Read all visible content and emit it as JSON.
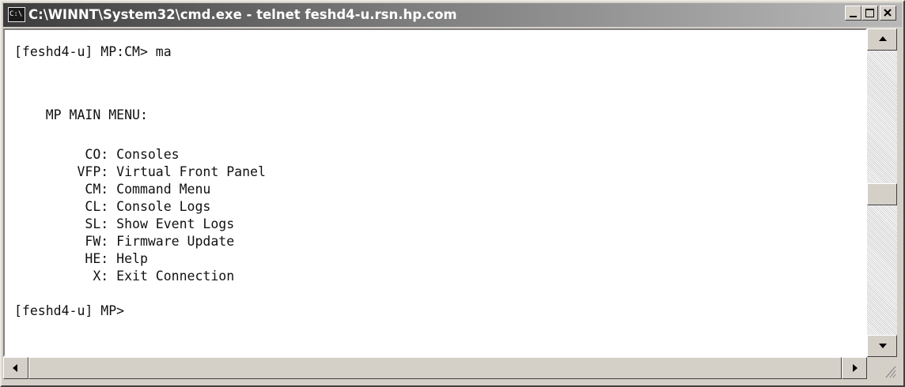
{
  "window": {
    "title": "C:\\WINNT\\System32\\cmd.exe - telnet feshd4-u.rsn.hp.com",
    "icon": "cmd-icon",
    "icon_glyph": "C:\\"
  },
  "terminal": {
    "lines": [
      "[feshd4-u] MP:CM> ma",
      "",
      "",
      "    MP MAIN MENU:",
      "",
      "         CO: Consoles",
      "        VFP: Virtual Front Panel",
      "         CM: Command Menu",
      "         CL: Console Logs",
      "         SL: Show Event Logs",
      "         FW: Firmware Update",
      "         HE: Help",
      "          X: Exit Connection",
      "",
      "[feshd4-u] MP>"
    ]
  },
  "controls": {
    "minimize_icon": "minimize-icon",
    "maximize_icon": "maximize-icon",
    "close_icon": "close-icon"
  }
}
